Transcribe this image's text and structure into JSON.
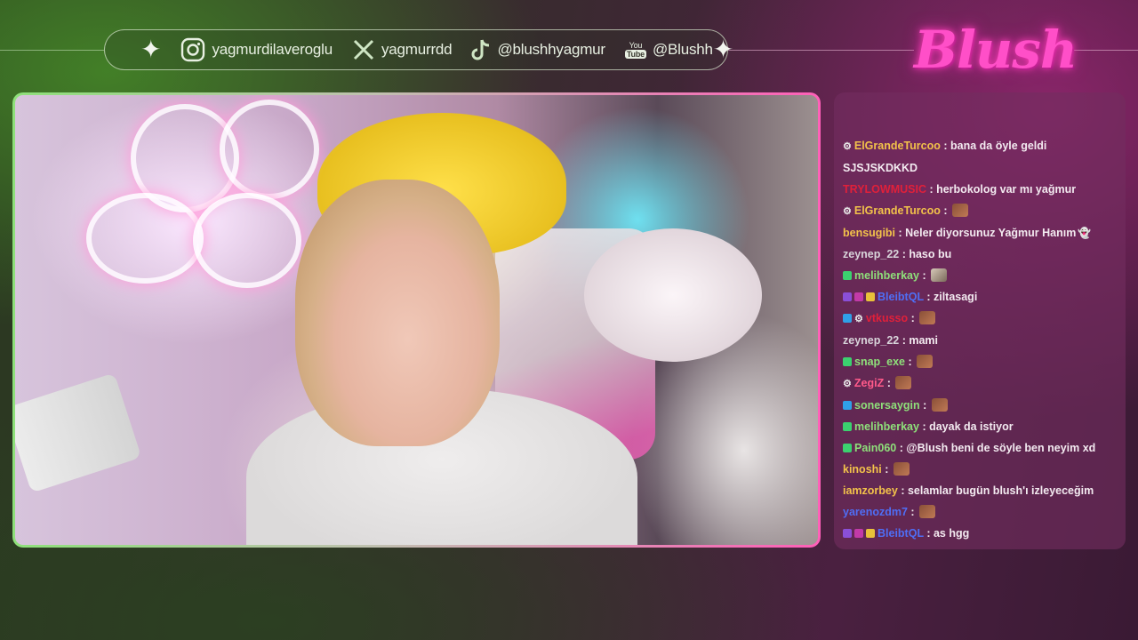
{
  "overlay": {
    "logo_text": "Blush",
    "socials": [
      {
        "icon": "instagram-icon",
        "handle": "yagmurdilaveroglu"
      },
      {
        "icon": "x-twitter-icon",
        "handle": "yagmurrdd"
      },
      {
        "icon": "tiktok-icon",
        "handle": "@blushhyagmur"
      },
      {
        "icon": "youtube-icon",
        "handle": "@Blushh",
        "icon_text_top": "You",
        "icon_text_bottom": "Tube"
      }
    ],
    "colors": {
      "accent_pink": "#ff4fc8",
      "accent_green": "#8ee07a",
      "chat_bg": "#732d5f"
    }
  },
  "chat": {
    "messages": [
      {
        "badges": [
          "gear"
        ],
        "user": "ElGrandeTurcoo",
        "color": "#f2c24a",
        "text": "bana da öyle geldi SJSJSKDKKD",
        "emote": ""
      },
      {
        "badges": [],
        "user": "TRYLOWMUSIC",
        "color": "#e0203a",
        "text": "herbokolog var mı yağmur",
        "emote": ""
      },
      {
        "badges": [
          "gear"
        ],
        "user": "ElGrandeTurcoo",
        "color": "#f2c24a",
        "text": "",
        "emote": "face"
      },
      {
        "badges": [],
        "user": "bensugibi",
        "color": "#f2c24a",
        "text": "Neler diyorsunuz Yağmur Hanım",
        "emote": "ghost"
      },
      {
        "badges": [],
        "user": "zeynep_22",
        "color": "#d8d4da",
        "text": "haso bu",
        "emote": ""
      },
      {
        "badges": [
          "green"
        ],
        "user": "melihberkay",
        "color": "#8ee07a",
        "text": "",
        "emote": "photo"
      },
      {
        "badges": [
          "purple",
          "gift",
          "crown"
        ],
        "user": "BleibtQL",
        "color": "#4f6ef5",
        "text": "ziltasagi",
        "emote": ""
      },
      {
        "badges": [
          "blue",
          "gear"
        ],
        "user": "vtkusso",
        "color": "#e0203a",
        "text": "",
        "emote": "face"
      },
      {
        "badges": [],
        "user": "zeynep_22",
        "color": "#d8d4da",
        "text": "mami",
        "emote": ""
      },
      {
        "badges": [
          "green"
        ],
        "user": "snap_exe",
        "color": "#8ee07a",
        "text": "",
        "emote": "face"
      },
      {
        "badges": [
          "gear"
        ],
        "user": "ZegiZ",
        "color": "#ff5a8a",
        "text": "",
        "emote": "face"
      },
      {
        "badges": [
          "blue"
        ],
        "user": "sonersaygin",
        "color": "#8ee07a",
        "text": "",
        "emote": "face"
      },
      {
        "badges": [
          "green"
        ],
        "user": "melihberkay",
        "color": "#8ee07a",
        "text": "dayak da istiyor",
        "emote": ""
      },
      {
        "badges": [
          "green"
        ],
        "user": "Pain060",
        "color": "#8ee07a",
        "text": "@Blush beni de söyle ben neyim xd",
        "emote": ""
      },
      {
        "badges": [],
        "user": "kinoshi",
        "color": "#f2c24a",
        "text": "",
        "emote": "face"
      },
      {
        "badges": [],
        "user": "iamzorbey",
        "color": "#f2c24a",
        "text": "selamlar bugün blush'ı izleyeceğim",
        "emote": ""
      },
      {
        "badges": [],
        "user": "yarenozdm7",
        "color": "#4f6ef5",
        "text": "",
        "emote": "face"
      },
      {
        "badges": [
          "purple",
          "gift",
          "crown"
        ],
        "user": "BleibtQL",
        "color": "#4f6ef5",
        "text": "as hgg",
        "emote": ""
      }
    ]
  }
}
